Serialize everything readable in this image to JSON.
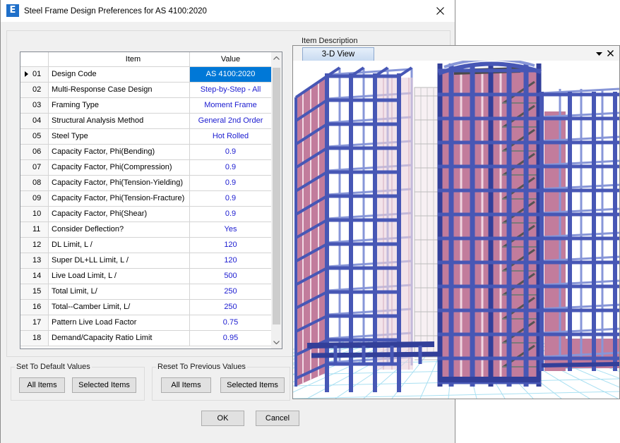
{
  "dialog": {
    "title": "Steel Frame Design Preferences for AS 4100:2020",
    "app_icon": "etabs-app-icon",
    "app_icon_letter": "E",
    "close_icon": "close-icon"
  },
  "item_description": {
    "label": "Item Description"
  },
  "grid": {
    "headers": {
      "item": "Item",
      "value": "Value"
    },
    "selected_row": 0,
    "row_pointer_icon": "row-pointer-icon",
    "scroll_up_icon": "chevron-up-icon",
    "scroll_down_icon": "chevron-down-icon",
    "rows": [
      {
        "no": "01",
        "item": "Design Code",
        "value": "AS 4100:2020"
      },
      {
        "no": "02",
        "item": "Multi-Response Case Design",
        "value": "Step-by-Step - All"
      },
      {
        "no": "03",
        "item": "Framing Type",
        "value": "Moment Frame"
      },
      {
        "no": "04",
        "item": "Structural Analysis Method",
        "value": "General 2nd Order"
      },
      {
        "no": "05",
        "item": "Steel Type",
        "value": "Hot Rolled"
      },
      {
        "no": "06",
        "item": "Capacity Factor, Phi(Bending)",
        "value": "0.9"
      },
      {
        "no": "07",
        "item": "Capacity Factor, Phi(Compression)",
        "value": "0.9"
      },
      {
        "no": "08",
        "item": "Capacity Factor, Phi(Tension-Yielding)",
        "value": "0.9"
      },
      {
        "no": "09",
        "item": "Capacity Factor, Phi(Tension-Fracture)",
        "value": "0.9"
      },
      {
        "no": "10",
        "item": "Capacity Factor, Phi(Shear)",
        "value": "0.9"
      },
      {
        "no": "11",
        "item": "Consider Deflection?",
        "value": "Yes"
      },
      {
        "no": "12",
        "item": "DL Limit, L /",
        "value": "120"
      },
      {
        "no": "13",
        "item": "Super DL+LL Limit, L /",
        "value": "120"
      },
      {
        "no": "14",
        "item": "Live Load Limit, L /",
        "value": "500"
      },
      {
        "no": "15",
        "item": "Total Limit, L/",
        "value": "250"
      },
      {
        "no": "16",
        "item": "Total--Camber Limit, L/",
        "value": "250"
      },
      {
        "no": "17",
        "item": "Pattern Live Load Factor",
        "value": "0.75"
      },
      {
        "no": "18",
        "item": "Demand/Capacity Ratio Limit",
        "value": "0.95"
      }
    ]
  },
  "set_default": {
    "label": "Set To Default Values",
    "all_items": "All Items",
    "selected_items": "Selected Items"
  },
  "reset_previous": {
    "label": "Reset To Previous Values",
    "all_items": "All Items",
    "selected_items": "Selected Items"
  },
  "actions": {
    "ok": "OK",
    "cancel": "Cancel"
  },
  "view_window": {
    "tab_label": "3-D View",
    "menu_icon": "dropdown-triangle-icon",
    "close_icon": "close-icon"
  },
  "colors": {
    "selection": "#0078d7",
    "value_text": "#1b1bd0",
    "frame_blue": "#4757b5",
    "frame_blue_dark": "#323f99",
    "frame_blue_light": "#8796d8",
    "wall_pink": "#c27c9c",
    "wall_pink_light": "#ead0dc",
    "stair_gray": "#555555",
    "ground_grid": "#a9e0f2"
  }
}
